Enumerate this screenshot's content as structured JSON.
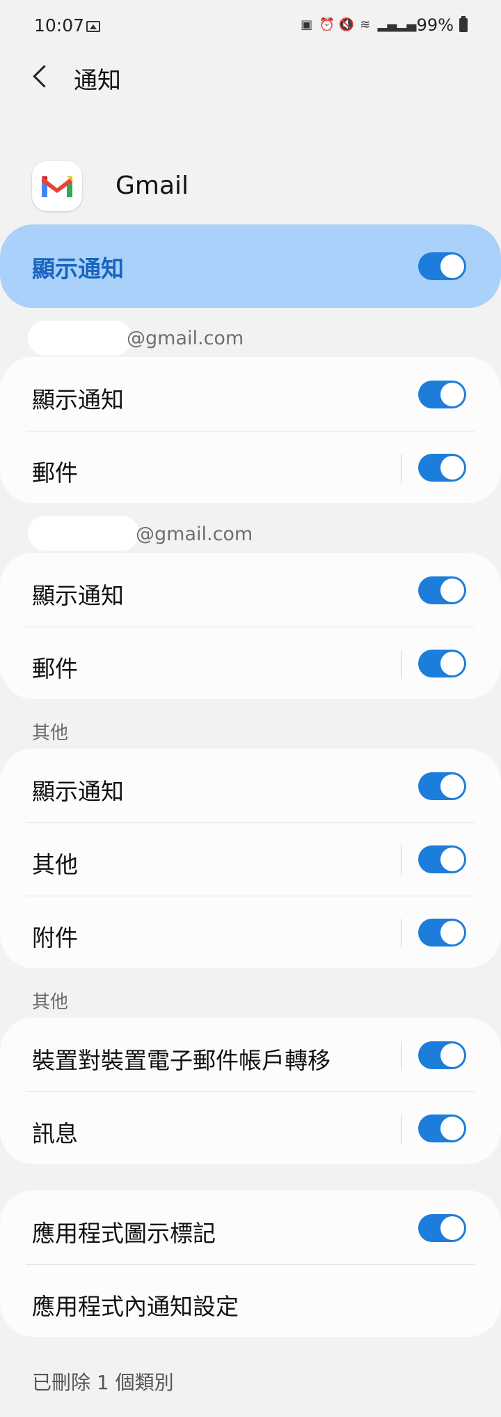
{
  "status_bar": {
    "time": "10:07",
    "signal_icons": [
      "image-icon",
      "battery-saver-icon",
      "alarm-icon",
      "mute-icon",
      "wifi-icon",
      "signal-icon"
    ],
    "battery": "99%"
  },
  "header": {
    "title": "通知"
  },
  "app": {
    "name": "Gmail",
    "icon": "gmail-icon"
  },
  "master_toggle": {
    "label": "顯示通知",
    "on": true
  },
  "accounts": [
    {
      "email_suffix": "@gmail.com",
      "rows": [
        "顯示通知",
        "郵件"
      ]
    },
    {
      "email_suffix": "@gmail.com",
      "rows": [
        "顯示通知",
        "郵件"
      ]
    }
  ],
  "section_other_1": {
    "title": "其他",
    "rows": [
      "顯示通知",
      "其他",
      "附件"
    ]
  },
  "section_other_2": {
    "title": "其他",
    "rows": [
      "裝置對裝置電子郵件帳戶轉移",
      "訊息"
    ]
  },
  "bottom_card": {
    "rows": [
      "應用程式圖示標記",
      "應用程式內通知設定"
    ]
  },
  "footer": "已刪除 1 個類別",
  "colors": {
    "accent": "#1c7ddb",
    "master_bg": "#a9d1fa",
    "master_text": "#1765c1"
  }
}
